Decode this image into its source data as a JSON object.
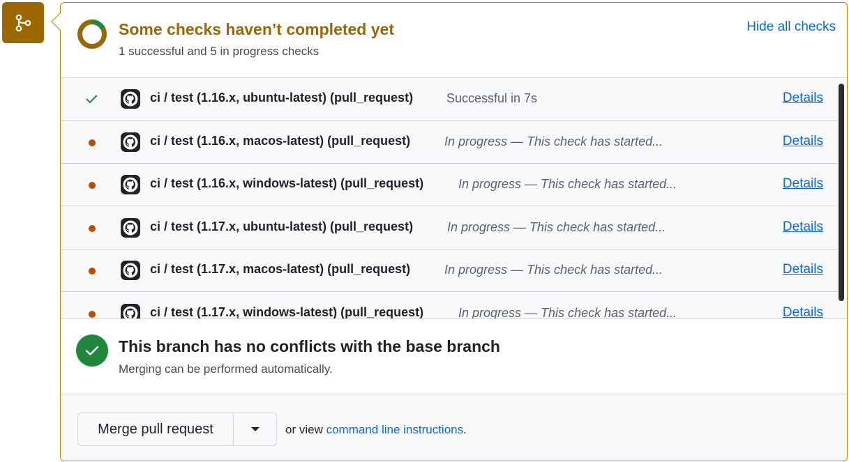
{
  "icons": {
    "branch": "git-merge-icon",
    "status_ring": "in-progress-ring-icon",
    "check_success": "check-icon",
    "check_pending": "dot-icon",
    "github": "github-logo-icon",
    "merge_ok": "check-circle-icon",
    "dropdown": "triangle-down-icon"
  },
  "colors": {
    "accent": "#9a6700",
    "border": "#bf8700",
    "success": "#1f883d",
    "pending": "#bc4c00",
    "link": "#0969da"
  },
  "status": {
    "title": "Some checks haven’t completed yet",
    "subtitle": "1 successful and 5 in progress checks",
    "hide_all_label": "Hide all checks",
    "progress_fraction": 0.17
  },
  "checks": [
    {
      "name": "ci / test (1.16.x, ubuntu-latest) (pull_request)",
      "state": "success",
      "description": "Successful in 7s",
      "details_label": "Details"
    },
    {
      "name": "ci / test (1.16.x, macos-latest) (pull_request)",
      "state": "in_progress",
      "description": "In progress — This check has started...",
      "details_label": "Details"
    },
    {
      "name": "ci / test (1.16.x, windows-latest) (pull_request)",
      "state": "in_progress",
      "description": "In progress — This check has started...",
      "details_label": "Details"
    },
    {
      "name": "ci / test (1.17.x, ubuntu-latest) (pull_request)",
      "state": "in_progress",
      "description": "In progress — This check has started...",
      "details_label": "Details"
    },
    {
      "name": "ci / test (1.17.x, macos-latest) (pull_request)",
      "state": "in_progress",
      "description": "In progress — This check has started...",
      "details_label": "Details"
    },
    {
      "name": "ci / test (1.17.x, windows-latest) (pull_request)",
      "state": "in_progress",
      "description": "In progress — This check has started...",
      "details_label": "Details"
    }
  ],
  "merge": {
    "title": "This branch has no conflicts with the base branch",
    "subtitle": "Merging can be performed automatically."
  },
  "footer": {
    "merge_button_label": "Merge pull request",
    "or_view_text": "or view ",
    "instructions_link": "command line instructions",
    "period": "."
  }
}
